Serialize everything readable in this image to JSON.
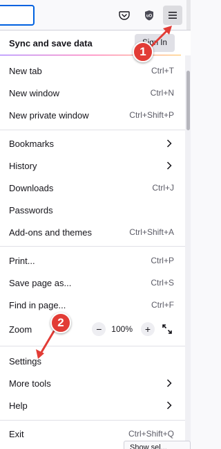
{
  "toolbar": {
    "pocket_icon": "pocket-icon",
    "ublock_icon": "ublock-icon",
    "menu_icon": "hamburger-menu-icon"
  },
  "sync": {
    "title": "Sync and save data",
    "signin": "Sign In"
  },
  "menu": {
    "new_tab": {
      "label": "New tab",
      "shortcut": "Ctrl+T"
    },
    "new_window": {
      "label": "New window",
      "shortcut": "Ctrl+N"
    },
    "new_private_window": {
      "label": "New private window",
      "shortcut": "Ctrl+Shift+P"
    },
    "bookmarks": {
      "label": "Bookmarks"
    },
    "history": {
      "label": "History"
    },
    "downloads": {
      "label": "Downloads",
      "shortcut": "Ctrl+J"
    },
    "passwords": {
      "label": "Passwords"
    },
    "addons": {
      "label": "Add-ons and themes",
      "shortcut": "Ctrl+Shift+A"
    },
    "print": {
      "label": "Print...",
      "shortcut": "Ctrl+P"
    },
    "save_page": {
      "label": "Save page as...",
      "shortcut": "Ctrl+S"
    },
    "find": {
      "label": "Find in page...",
      "shortcut": "Ctrl+F"
    },
    "zoom": {
      "label": "Zoom",
      "minus": "−",
      "level": "100%",
      "plus": "+"
    },
    "settings": {
      "label": "Settings"
    },
    "more_tools": {
      "label": "More tools"
    },
    "help": {
      "label": "Help"
    },
    "exit": {
      "label": "Exit",
      "shortcut": "Ctrl+Shift+Q"
    }
  },
  "annotations": {
    "badge1": "1",
    "badge2": "2",
    "color": "#e23c36"
  },
  "tooltip": "Show sel..."
}
